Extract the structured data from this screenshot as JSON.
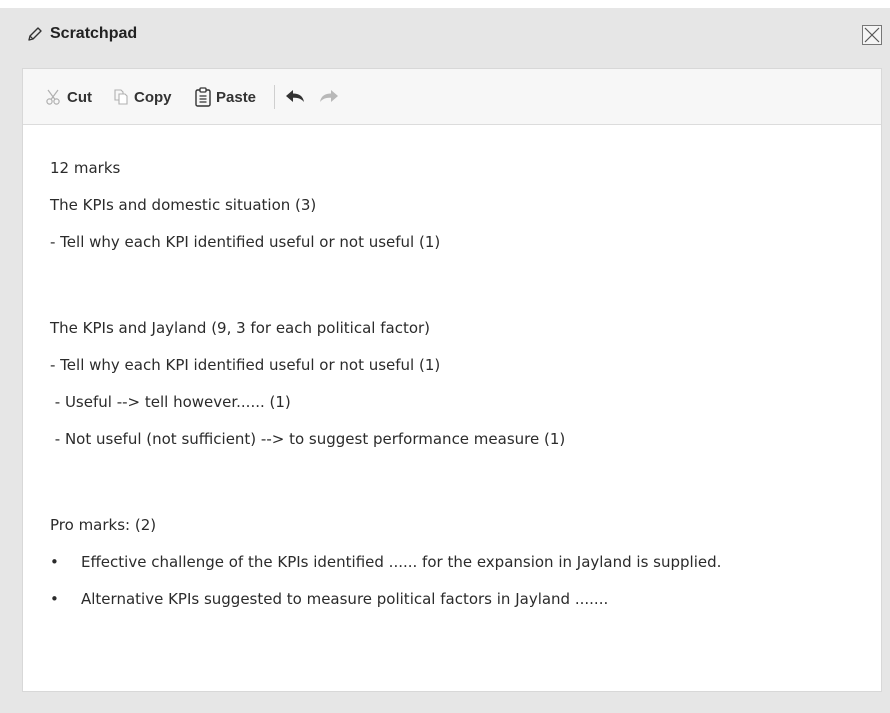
{
  "window": {
    "title": "Scratchpad"
  },
  "toolbar": {
    "cut_label": "Cut",
    "copy_label": "Copy",
    "paste_label": "Paste"
  },
  "icons": {
    "title": "pencil-icon",
    "close": "close-icon",
    "cut": "scissors-icon",
    "copy": "copy-icon",
    "paste": "clipboard-icon",
    "undo": "undo-icon",
    "redo": "redo-icon"
  },
  "content": {
    "lines": [
      "12 marks",
      "The KPIs and domestic situation (3)",
      "- Tell why each KPI identified useful or not useful (1)",
      "The KPIs and Jayland (9, 3 for each political factor)",
      "- Tell why each KPI identified useful or not useful (1)",
      " - Useful --> tell however...... (1)",
      " - Not useful (not sufficient) --> to suggest performance measure (1)",
      "Pro marks: (2)"
    ],
    "bullets": [
      "Effective challenge of the KPIs identified ...... for the expansion in Jayland is supplied.",
      "Alternative KPIs suggested to measure political factors in Jayland ......."
    ],
    "bullet_char": "•"
  },
  "colors": {
    "window_bg": "#e6e6e6",
    "panel_bg": "#ffffff",
    "toolbar_bg": "#f7f7f7",
    "text": "#2b2b2b",
    "disabled_icon": "#b0b0b0"
  }
}
